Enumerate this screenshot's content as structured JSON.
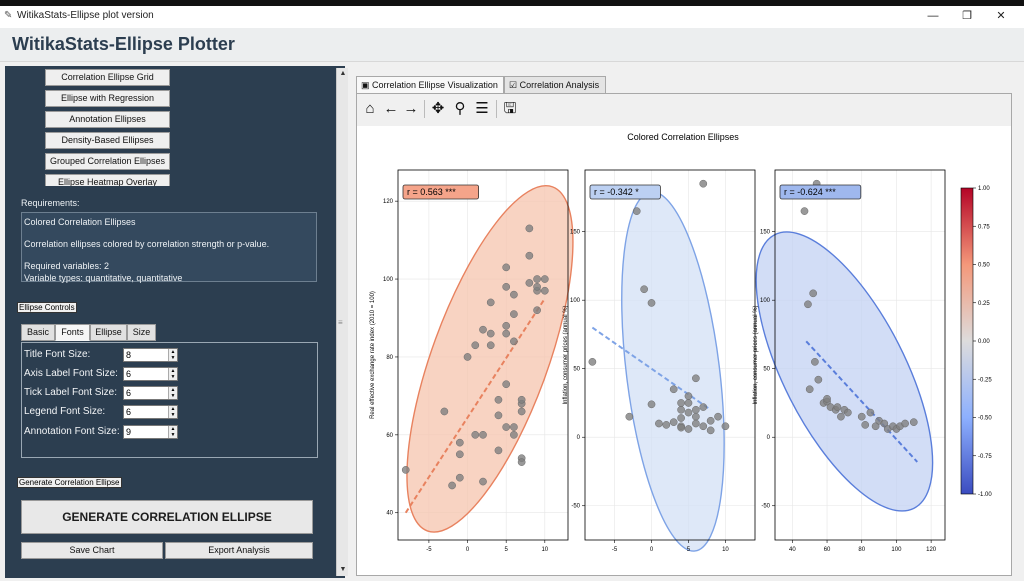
{
  "window": {
    "title": "WitikaStats-Ellipse plot version",
    "minimize": "—",
    "restore": "❐",
    "close": "✕"
  },
  "header": {
    "title": "WitikaStats-Ellipse Plotter"
  },
  "plot_types": [
    "Correlation Ellipse Grid",
    "Ellipse with Regression",
    "Annotation Ellipses",
    "Density-Based Ellipses",
    "Grouped Correlation Ellipses",
    "Ellipse Heatmap Overlay"
  ],
  "requirements": {
    "label": "Requirements:",
    "name": "Colored Correlation Ellipses",
    "description": "Correlation ellipses colored by correlation strength or p-value.",
    "vars": "Required variables: 2",
    "types": "Variable types: quantitative, quantitative"
  },
  "controls": {
    "section_label": "Ellipse Controls",
    "tabs": [
      "Basic",
      "Fonts",
      "Ellipse",
      "Size"
    ],
    "active_tab": "Fonts",
    "fonts": [
      {
        "label": "Title Font Size:",
        "value": "8"
      },
      {
        "label": "Axis Label Font Size:",
        "value": "6"
      },
      {
        "label": "Tick Label Font Size:",
        "value": "6"
      },
      {
        "label": "Legend Font Size:",
        "value": "6"
      },
      {
        "label": "Annotation Font Size:",
        "value": "9"
      }
    ]
  },
  "actions": {
    "section_label": "Generate Correlation Ellipse",
    "generate": "GENERATE CORRELATION ELLIPSE",
    "save": "Save Chart",
    "export": "Export Analysis"
  },
  "main_tabs": [
    "Correlation Ellipse Visualization",
    "Correlation Analysis"
  ],
  "toolbar": [
    "home-icon",
    "back-icon",
    "forward-icon",
    "pan-icon",
    "zoom-icon",
    "configure-icon",
    "save-icon"
  ],
  "chart_data": {
    "type": "scatter",
    "title": "Colored Correlation Ellipses",
    "colorbar": {
      "min": -1.0,
      "max": 1.0,
      "ticks": [
        "1.00",
        "0.75",
        "0.50",
        "0.25",
        "0.00",
        "-0.25",
        "-0.50",
        "-0.75",
        "-1.00"
      ],
      "colormap": "coolwarm"
    },
    "panels": [
      {
        "annotation": "r = 0.563 ***",
        "ylabel": "Real effective exchange rate index (2010 = 100)",
        "xlabel": "",
        "color": "#e8825f",
        "fill": "#f5c4ae",
        "label_bg": "#f5a48a",
        "xlim": [
          -9,
          13
        ],
        "ylim": [
          33,
          128
        ],
        "xticks": [
          -5,
          0,
          5,
          10
        ],
        "yticks": [
          40,
          60,
          80,
          100,
          120
        ],
        "ellipse": {
          "cx": 2.9,
          "cy": 79.5,
          "rx": 7.5,
          "ry": 47,
          "angle": 20
        },
        "regression": [
          [
            -8,
            40
          ],
          [
            10,
            95
          ]
        ],
        "points": [
          [
            -8,
            51
          ],
          [
            -3,
            66
          ],
          [
            -2,
            47
          ],
          [
            -1,
            55
          ],
          [
            -1,
            49
          ],
          [
            -1,
            58
          ],
          [
            0,
            80
          ],
          [
            1,
            83
          ],
          [
            2,
            48
          ],
          [
            2,
            60
          ],
          [
            2,
            87
          ],
          [
            3,
            86
          ],
          [
            3,
            83
          ],
          [
            3,
            94
          ],
          [
            4,
            69
          ],
          [
            4,
            65
          ],
          [
            4,
            56
          ],
          [
            5,
            103
          ],
          [
            5,
            98
          ],
          [
            5,
            88
          ],
          [
            5,
            86
          ],
          [
            5,
            62
          ],
          [
            5,
            73
          ],
          [
            6,
            96
          ],
          [
            6,
            84
          ],
          [
            6,
            62
          ],
          [
            6,
            60
          ],
          [
            7,
            66
          ],
          [
            7,
            68
          ],
          [
            7,
            69
          ],
          [
            7,
            54
          ],
          [
            7,
            53
          ],
          [
            8,
            99
          ],
          [
            8,
            106
          ],
          [
            8,
            113
          ],
          [
            9,
            97
          ],
          [
            9,
            92
          ],
          [
            9,
            98
          ],
          [
            9,
            100
          ],
          [
            10,
            100
          ],
          [
            10,
            97
          ],
          [
            6,
            91
          ],
          [
            1,
            60
          ]
        ]
      },
      {
        "annotation": "r = -0.342 *",
        "ylabel": "Inflation, consumer prices (annual %)",
        "xlabel": "",
        "color": "#7ea3e6",
        "fill": "#d3e0f6",
        "label_bg": "#bcd0f2",
        "xlim": [
          -9,
          14
        ],
        "ylim": [
          -75,
          195
        ],
        "xticks": [
          -5,
          0,
          5,
          10
        ],
        "yticks": [
          -50,
          0,
          50,
          100,
          150
        ],
        "ellipse": {
          "cx": 2.9,
          "cy": 48,
          "rx": 6.3,
          "ry": 132,
          "angle": -7
        },
        "regression": [
          [
            -8,
            80
          ],
          [
            8,
            20
          ]
        ],
        "points": [
          [
            -8,
            55
          ],
          [
            -3,
            15
          ],
          [
            -2,
            165
          ],
          [
            -1,
            108
          ],
          [
            0,
            98
          ],
          [
            0,
            24
          ],
          [
            1,
            10
          ],
          [
            2,
            9
          ],
          [
            3,
            11
          ],
          [
            3,
            35
          ],
          [
            4,
            25
          ],
          [
            4,
            20
          ],
          [
            4,
            8
          ],
          [
            4,
            7
          ],
          [
            5,
            30
          ],
          [
            5,
            25
          ],
          [
            5,
            18
          ],
          [
            5,
            6
          ],
          [
            6,
            20
          ],
          [
            6,
            43
          ],
          [
            6,
            15
          ],
          [
            7,
            22
          ],
          [
            7,
            8
          ],
          [
            7,
            185
          ],
          [
            8,
            12
          ],
          [
            8,
            5
          ],
          [
            9,
            15
          ],
          [
            10,
            8
          ],
          [
            6,
            10
          ],
          [
            4,
            14
          ]
        ]
      },
      {
        "annotation": "r = -0.624 ***",
        "ylabel": "Inflation, consumer prices (annual %)",
        "xlabel": "",
        "color": "#5a7edb",
        "fill": "#c3d1f3",
        "label_bg": "#9fb8ee",
        "xlim": [
          30,
          128
        ],
        "ylim": [
          -75,
          195
        ],
        "xticks": [
          40,
          60,
          80,
          100,
          120
        ],
        "yticks": [
          -50,
          0,
          50,
          100,
          150
        ],
        "ellipse": {
          "cx": 70,
          "cy": 48,
          "rx": 35,
          "ry": 112,
          "angle": -27
        },
        "regression": [
          [
            48,
            70
          ],
          [
            112,
            -18
          ]
        ],
        "points": [
          [
            47,
            165
          ],
          [
            49,
            97
          ],
          [
            50,
            35
          ],
          [
            52,
            105
          ],
          [
            53,
            55
          ],
          [
            55,
            42
          ],
          [
            58,
            25
          ],
          [
            60,
            26
          ],
          [
            62,
            22
          ],
          [
            65,
            20
          ],
          [
            66,
            22
          ],
          [
            68,
            15
          ],
          [
            70,
            20
          ],
          [
            72,
            18
          ],
          [
            80,
            15
          ],
          [
            82,
            9
          ],
          [
            85,
            18
          ],
          [
            88,
            8
          ],
          [
            90,
            12
          ],
          [
            93,
            10
          ],
          [
            95,
            6
          ],
          [
            98,
            8
          ],
          [
            100,
            6
          ],
          [
            102,
            8
          ],
          [
            105,
            10
          ],
          [
            110,
            11
          ],
          [
            54,
            185
          ],
          [
            60,
            28
          ]
        ]
      }
    ]
  }
}
